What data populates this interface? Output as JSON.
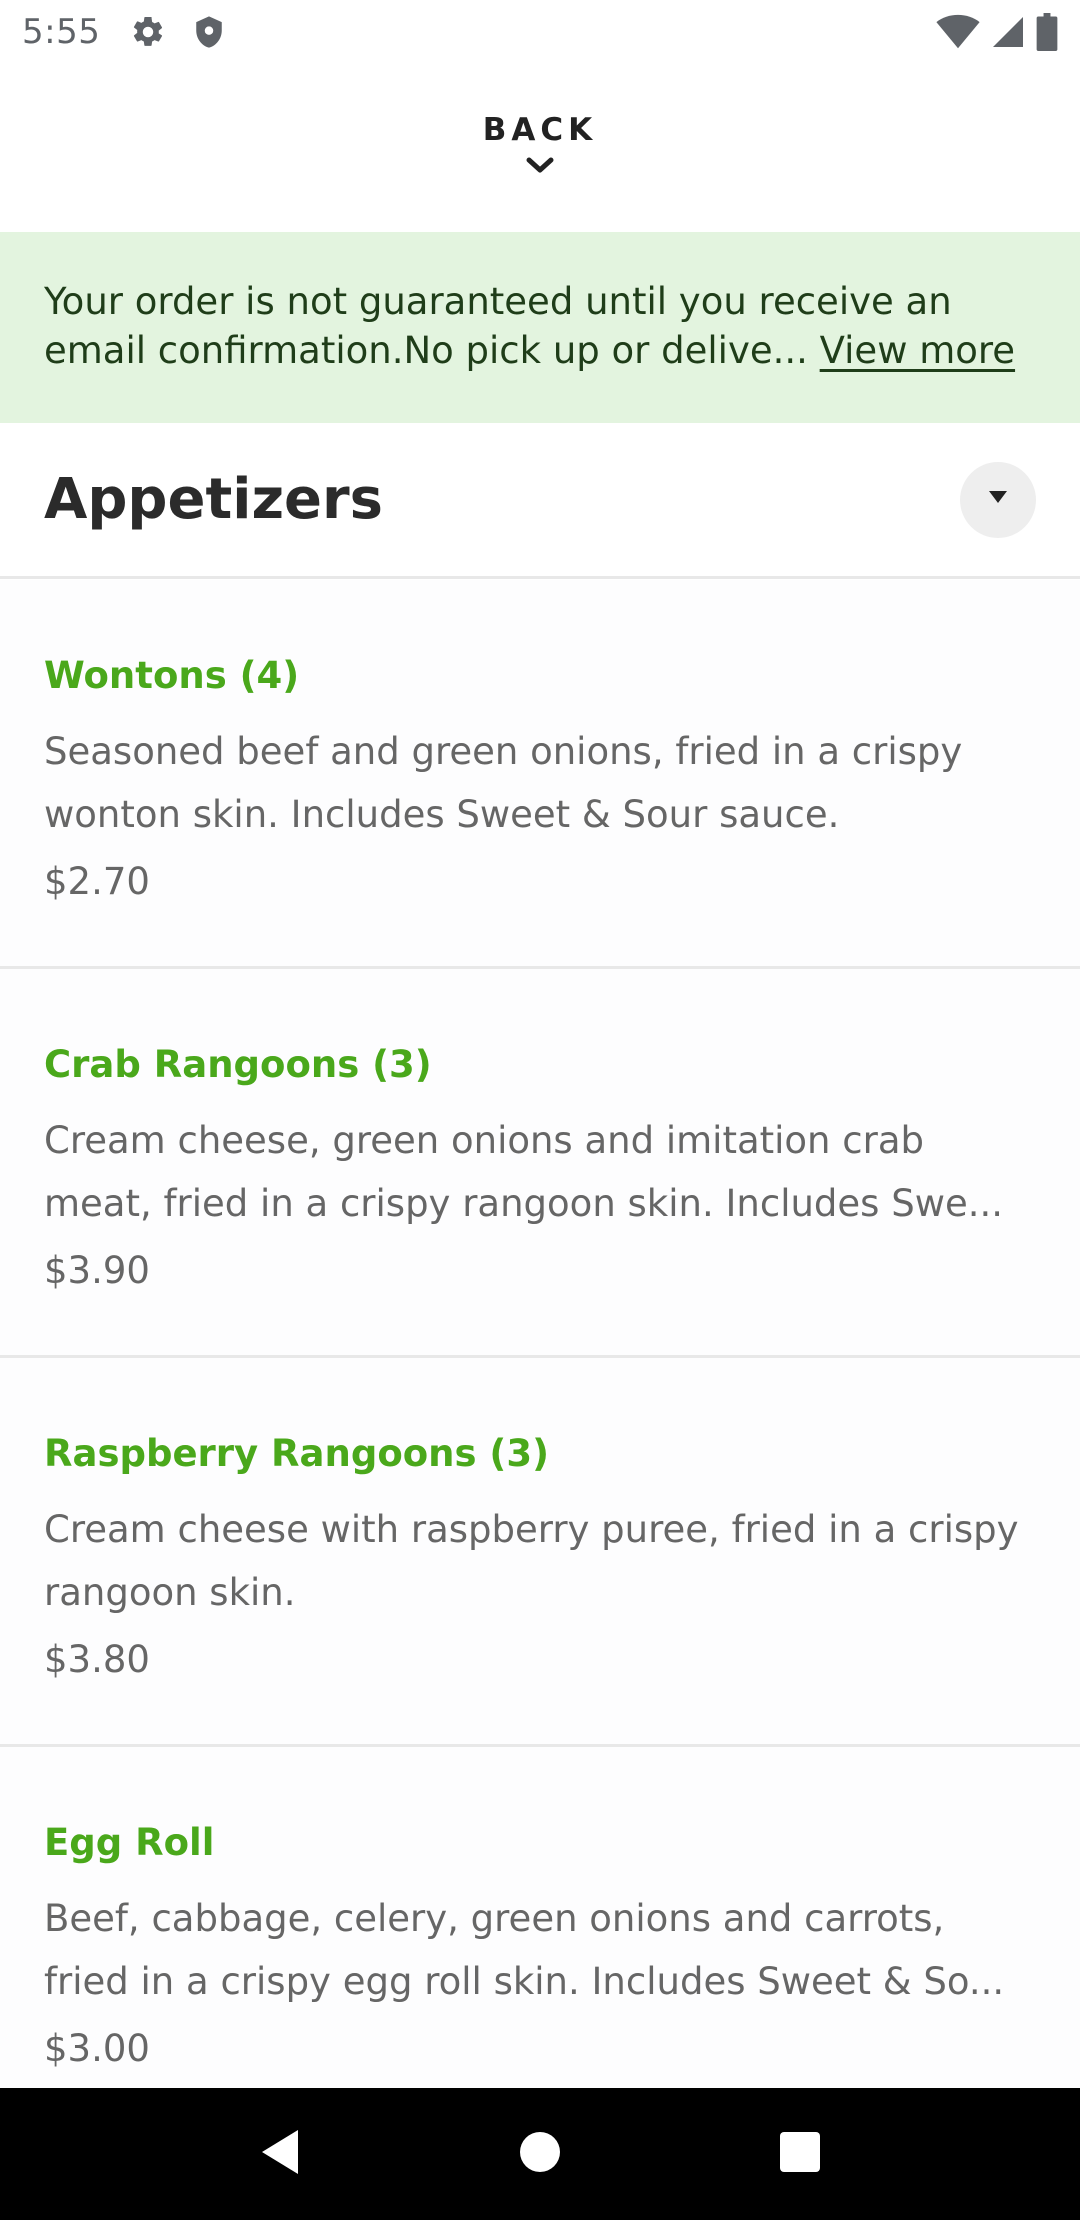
{
  "status_bar": {
    "time": "5:55",
    "icons": [
      "settings-icon",
      "shield-icon",
      "wifi-icon",
      "cell-signal-icon",
      "battery-icon"
    ]
  },
  "header": {
    "back_label": "BACK"
  },
  "notice": {
    "text": "Your order is not guaranteed until you receive an email confirmation.No pick up or delive...",
    "link_label": "View more",
    "background": "#e3f4df"
  },
  "category": {
    "title": "Appetizers"
  },
  "menu_items": [
    {
      "name": "Wontons (4)",
      "description": "Seasoned beef and green onions, fried in a crispy wonton skin. Includes Sweet & Sour sauce.",
      "price": "$2.70"
    },
    {
      "name": "Crab Rangoons (3)",
      "description": "Cream cheese, green onions and imitation crab meat, fried in a crispy rangoon skin.  Includes Swe...",
      "price": "$3.90"
    },
    {
      "name": "Raspberry Rangoons (3)",
      "description": "Cream cheese with raspberry puree, fried in a crispy rangoon skin.",
      "price": "$3.80"
    },
    {
      "name": "Egg Roll",
      "description": "Beef, cabbage, celery, green onions and carrots, fried in a crispy egg roll skin.  Includes Sweet & So...",
      "price": "$3.00"
    }
  ],
  "colors": {
    "accent_green": "#4aa81b",
    "text_gray": "#666666"
  }
}
